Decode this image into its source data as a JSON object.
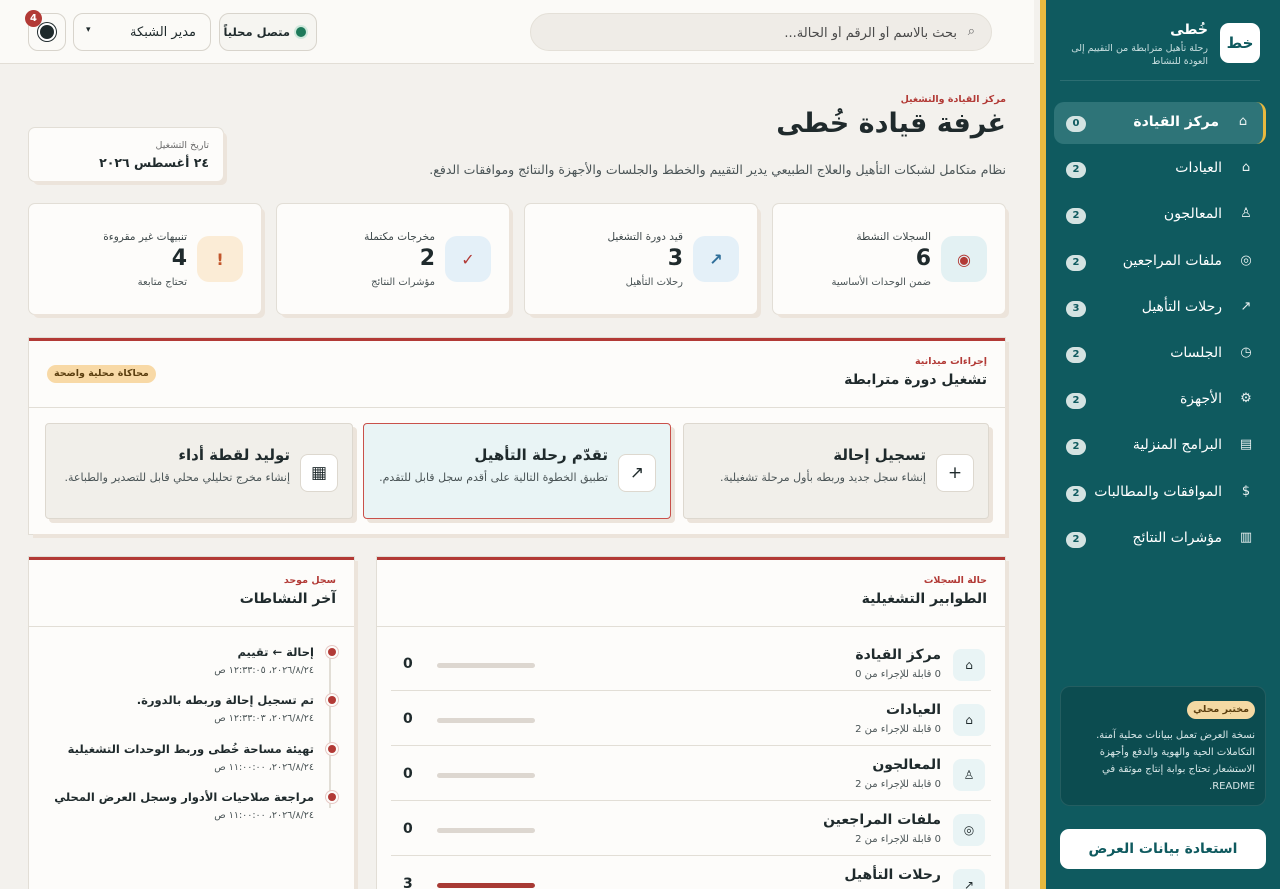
{
  "topbar": {
    "search_placeholder": "بحث بالاسم أو الرقم أو الحالة...",
    "search_icon": "⌕",
    "status_label": "متصل محلياً",
    "role_selected": "مدير الشبكة",
    "role_chevron": "▾",
    "notification_count": "4"
  },
  "sidebar": {
    "logo_text": "خط",
    "app_name": "خُطى",
    "tagline": "رحلة تأهيل مترابطة من التقييم إلى العودة للنشاط",
    "items": [
      {
        "icon": "⌂",
        "label": "مركز القيادة",
        "badge": "0",
        "active": true
      },
      {
        "icon": "⌂",
        "label": "العيادات",
        "badge": "2"
      },
      {
        "icon": "♙",
        "label": "المعالجون",
        "badge": "2"
      },
      {
        "icon": "◎",
        "label": "ملفات المراجعين",
        "badge": "2"
      },
      {
        "icon": "↗",
        "label": "رحلات التأهيل",
        "badge": "3"
      },
      {
        "icon": "◷",
        "label": "الجلسات",
        "badge": "2"
      },
      {
        "icon": "⚙",
        "label": "الأجهزة",
        "badge": "2"
      },
      {
        "icon": "▤",
        "label": "البرامج المنزلية",
        "badge": "2"
      },
      {
        "icon": "$",
        "label": "الموافقات والمطالبات",
        "badge": "2"
      },
      {
        "icon": "▥",
        "label": "مؤشرات النتائج",
        "badge": "2"
      }
    ],
    "demo_badge": "مختبر محلي",
    "demo_text": "نسخة العرض تعمل ببيانات محلية آمنة. التكاملات الحية والهوية والدفع وأجهزة الاستشعار تحتاج بوابة إنتاج موثقة في README.",
    "restore_label": "استعادة بيانات العرض"
  },
  "header": {
    "eyebrow": "مركز القيادة والتشغيل",
    "title": "غرفة قيادة خُطى",
    "subtitle": "نظام متكامل لشبكات التأهيل والعلاج الطبيعي يدير التقييم والخطط والجلسات والأجهزة والنتائج وموافقات الدفع.",
    "date_label": "تاريخ التشغيل",
    "date_value": "٢٤ أغسطس ٢٠٢٦"
  },
  "stats": [
    {
      "icon": "◉",
      "label": "السجلات النشطة",
      "value": "6",
      "hint": "ضمن الوحدات الأساسية",
      "icon_bg": "#e3f1f3",
      "icon_color": "#b23a36"
    },
    {
      "icon": "↗",
      "label": "قيد دورة التشغيل",
      "value": "3",
      "hint": "رحلات التأهيل",
      "icon_bg": "#e4f0f8",
      "icon_color": "#2f6f9a"
    },
    {
      "icon": "✓",
      "label": "مخرجات مكتملة",
      "value": "2",
      "hint": "مؤشرات النتائج",
      "icon_bg": "#e4f0f8",
      "icon_color": "#b23a36"
    },
    {
      "icon": "!",
      "label": "تنبيهات غير مقروءة",
      "value": "4",
      "hint": "تحتاج متابعة",
      "icon_bg": "#fbecd6",
      "icon_color": "#c2562b"
    }
  ],
  "actions_panel": {
    "eyebrow": "إجراءات ميدانية",
    "title": "تشغيل دورة مترابطة",
    "badge": "محاكاة محلية واضحة",
    "cards": [
      {
        "icon": "+",
        "title": "تسجيل إحالة",
        "desc": "إنشاء سجل جديد وربطه بأول مرحلة تشغيلية."
      },
      {
        "icon": "↗",
        "title": "تقدّم رحلة التأهيل",
        "desc": "تطبيق الخطوة التالية على أقدم سجل قابل للتقدم.",
        "active": true
      },
      {
        "icon": "▦",
        "title": "توليد لقطة أداء",
        "desc": "إنشاء مخرج تحليلي محلي قابل للتصدير والطباعة."
      }
    ]
  },
  "queues_panel": {
    "eyebrow": "حالة السجلات",
    "title": "الطوابير التشغيلية",
    "rows": [
      {
        "icon": "⌂",
        "name": "مركز القيادة",
        "sub": "0 قابلة للإجراء من 0",
        "count": "0",
        "progress": 0
      },
      {
        "icon": "⌂",
        "name": "العيادات",
        "sub": "0 قابلة للإجراء من 2",
        "count": "0",
        "progress": 0
      },
      {
        "icon": "♙",
        "name": "المعالجون",
        "sub": "0 قابلة للإجراء من 2",
        "count": "0",
        "progress": 0
      },
      {
        "icon": "◎",
        "name": "ملفات المراجعين",
        "sub": "0 قابلة للإجراء من 2",
        "count": "0",
        "progress": 0
      },
      {
        "icon": "↗",
        "name": "رحلات التأهيل",
        "sub": "",
        "count": "3",
        "progress": 1
      }
    ]
  },
  "activity_panel": {
    "eyebrow": "سجل موحد",
    "title": "آخر النشاطات",
    "items": [
      {
        "text": "إحالة ← تقييم",
        "time": "٢٠٢٦/٨/٢٤، ١٢:٣٣:٠٥ ص"
      },
      {
        "text": "تم تسجيل إحالة وربطه بالدورة.",
        "time": "٢٠٢٦/٨/٢٤، ١٢:٣٣:٠٣ ص"
      },
      {
        "text": "تهيئة مساحة خُطى وربط الوحدات التشغيلية",
        "time": "٢٠٢٦/٨/٢٤، ١١:٠٠:٠٠ ص"
      },
      {
        "text": "مراجعة صلاحيات الأدوار وسجل العرض المحلي",
        "time": "٢٠٢٦/٨/٢٤، ١١:٠٠:٠٠ ص"
      }
    ]
  }
}
